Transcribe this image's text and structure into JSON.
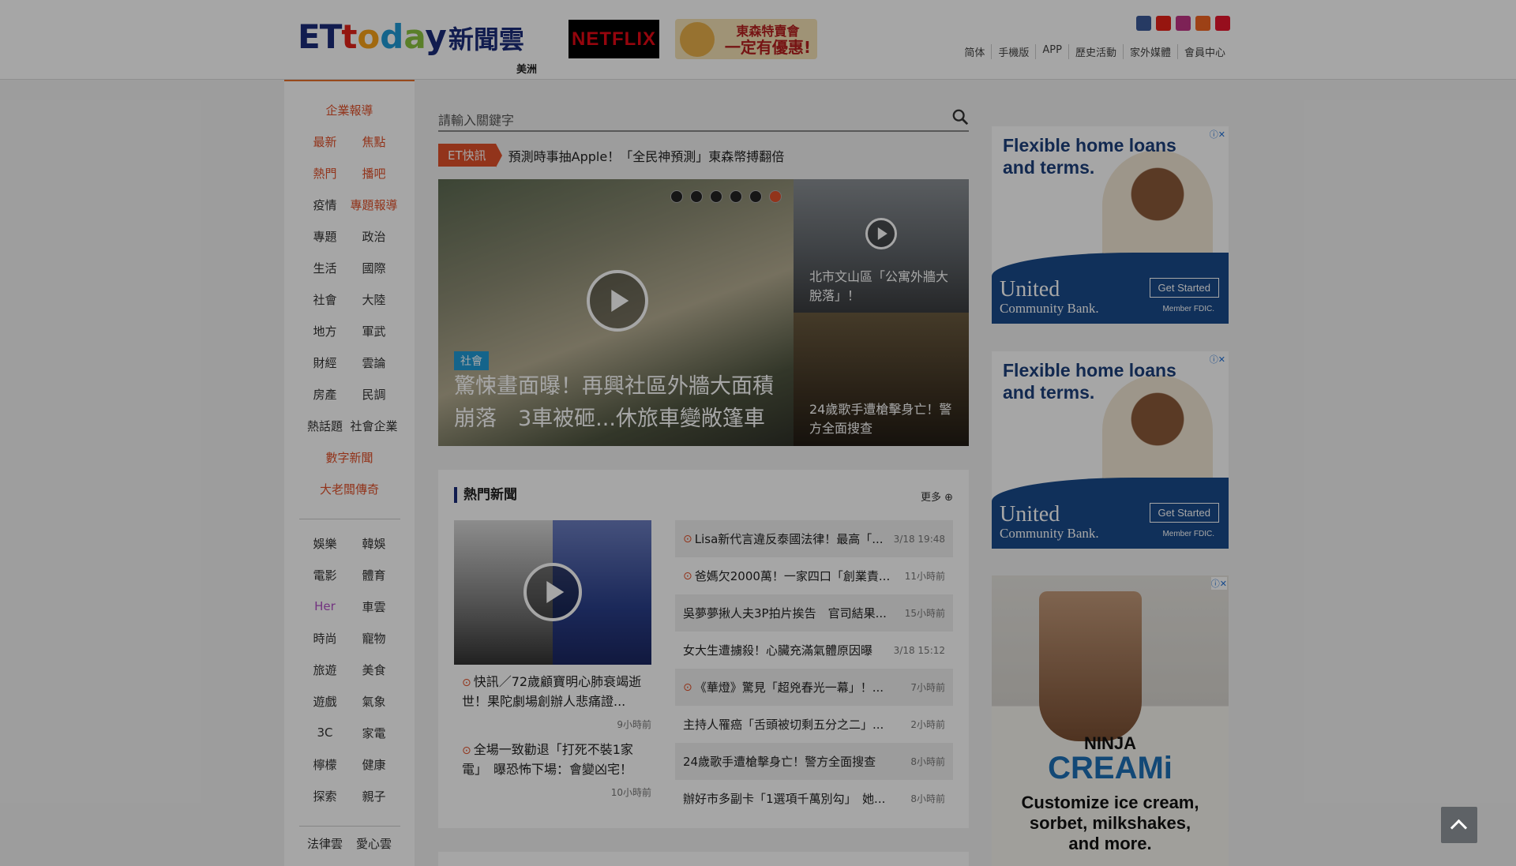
{
  "header": {
    "logo_et": "ET",
    "logo_today": [
      "t",
      "o",
      "d",
      "a",
      "y"
    ],
    "logo_cloud": "新聞雲",
    "region": "美洲",
    "netflix": "NETFLIX",
    "sale_banner": [
      "東森特賣會",
      "一定有優惠!"
    ],
    "socials": [
      {
        "icon": "facebook-icon",
        "color": "#3b5998"
      },
      {
        "icon": "youtube-icon",
        "color": "#e62117"
      },
      {
        "icon": "instagram-icon",
        "color": "#c13584"
      },
      {
        "icon": "rss-icon",
        "color": "#f26522"
      },
      {
        "icon": "weibo-icon",
        "color": "#e6162d"
      }
    ],
    "links": [
      "简体",
      "手機版",
      "APP",
      "歷史活動",
      "家外媒體",
      "會員中心"
    ]
  },
  "leftnav": {
    "top_single": "企業報導",
    "rows1": [
      [
        "最新",
        "焦點"
      ],
      [
        "熱門",
        "播吧"
      ],
      [
        "疫情",
        "專題報導"
      ],
      [
        "專題",
        "政治"
      ],
      [
        "生活",
        "國際"
      ],
      [
        "社會",
        "大陸"
      ],
      [
        "地方",
        "軍武"
      ],
      [
        "財經",
        "雲論"
      ],
      [
        "房產",
        "民調"
      ],
      [
        "熱話題",
        "社會企業"
      ]
    ],
    "digit": "數字新聞",
    "boss": "大老闆傳奇",
    "rows2": [
      [
        "娛樂",
        "韓娛"
      ],
      [
        "電影",
        "體育"
      ],
      [
        "Her",
        "車雲"
      ],
      [
        "時尚",
        "寵物"
      ],
      [
        "旅遊",
        "美食"
      ],
      [
        "遊戲",
        "氣象"
      ],
      [
        "3C",
        "家電"
      ],
      [
        "檸檬",
        "健康"
      ],
      [
        "探索",
        "親子"
      ]
    ],
    "bottom_partial": [
      "法律雲",
      "愛心雲"
    ]
  },
  "search": {
    "placeholder": "請輸入關鍵字"
  },
  "ticker": {
    "tag": "ET快訊",
    "text": "預測時事抽Apple！「全民神預測」東森幣搏翻倍"
  },
  "hero": {
    "category": "社會",
    "title": "驚悚畫面曝！再興社區外牆大面積崩落　3車被砸...休旅車變敞篷車",
    "side1": "北市文山區「公寓外牆大脫落」！",
    "side2": "24歲歌手遭槍擊身亡！警方全面搜查",
    "dots_count": 6,
    "active_dot": 6
  },
  "hot": {
    "heading": "熱門新聞",
    "more": "更多",
    "left_items": [
      {
        "text": "快訊／72歲顧寶明心肺衰竭逝世！果陀劇場創辦人悲痛證...",
        "time": "9小時前"
      },
      {
        "text": "全場一致勸退「打死不裝1家電」　曝恐怖下場：會變凶宅！",
        "time": "10小時前"
      }
    ],
    "list": [
      {
        "video": true,
        "text": "Lisa新代言違反泰國法律！最高「...",
        "time": "3/18 19:48"
      },
      {
        "video": true,
        "text": "爸媽欠2000萬！一家四口「創業責...",
        "time": "11小時前"
      },
      {
        "video": false,
        "text": "吳夢夢揪人夫3P拍片挨告　官司結果...",
        "time": "15小時前"
      },
      {
        "video": false,
        "text": "女大生遭擄殺！心臟充滿氣體原因曝",
        "time": "3/18 15:12"
      },
      {
        "video": true,
        "text": "《華燈》驚見「超兇春光一幕」！...",
        "time": "7小時前"
      },
      {
        "video": false,
        "text": "主持人罹癌「舌頭被切剩五分之二」...",
        "time": "2小時前"
      },
      {
        "video": false,
        "text": "24歲歌手遭槍擊身亡！警方全面搜查",
        "time": "8小時前"
      },
      {
        "video": false,
        "text": "辦好市多副卡「1選項千萬別勾」　她...",
        "time": "8小時前"
      }
    ]
  },
  "ads": {
    "bank": {
      "headline": [
        "Flexible home loans",
        "and terms."
      ],
      "name": "United",
      "sub": "Community Bank.",
      "cta": "Get Started",
      "fdic": "Member FDIC."
    },
    "ninja": {
      "brand": "NINJA",
      "product": "CREAMi",
      "desc": [
        "Customize ice cream,",
        "sorbet, milkshakes,",
        "and more."
      ]
    }
  }
}
